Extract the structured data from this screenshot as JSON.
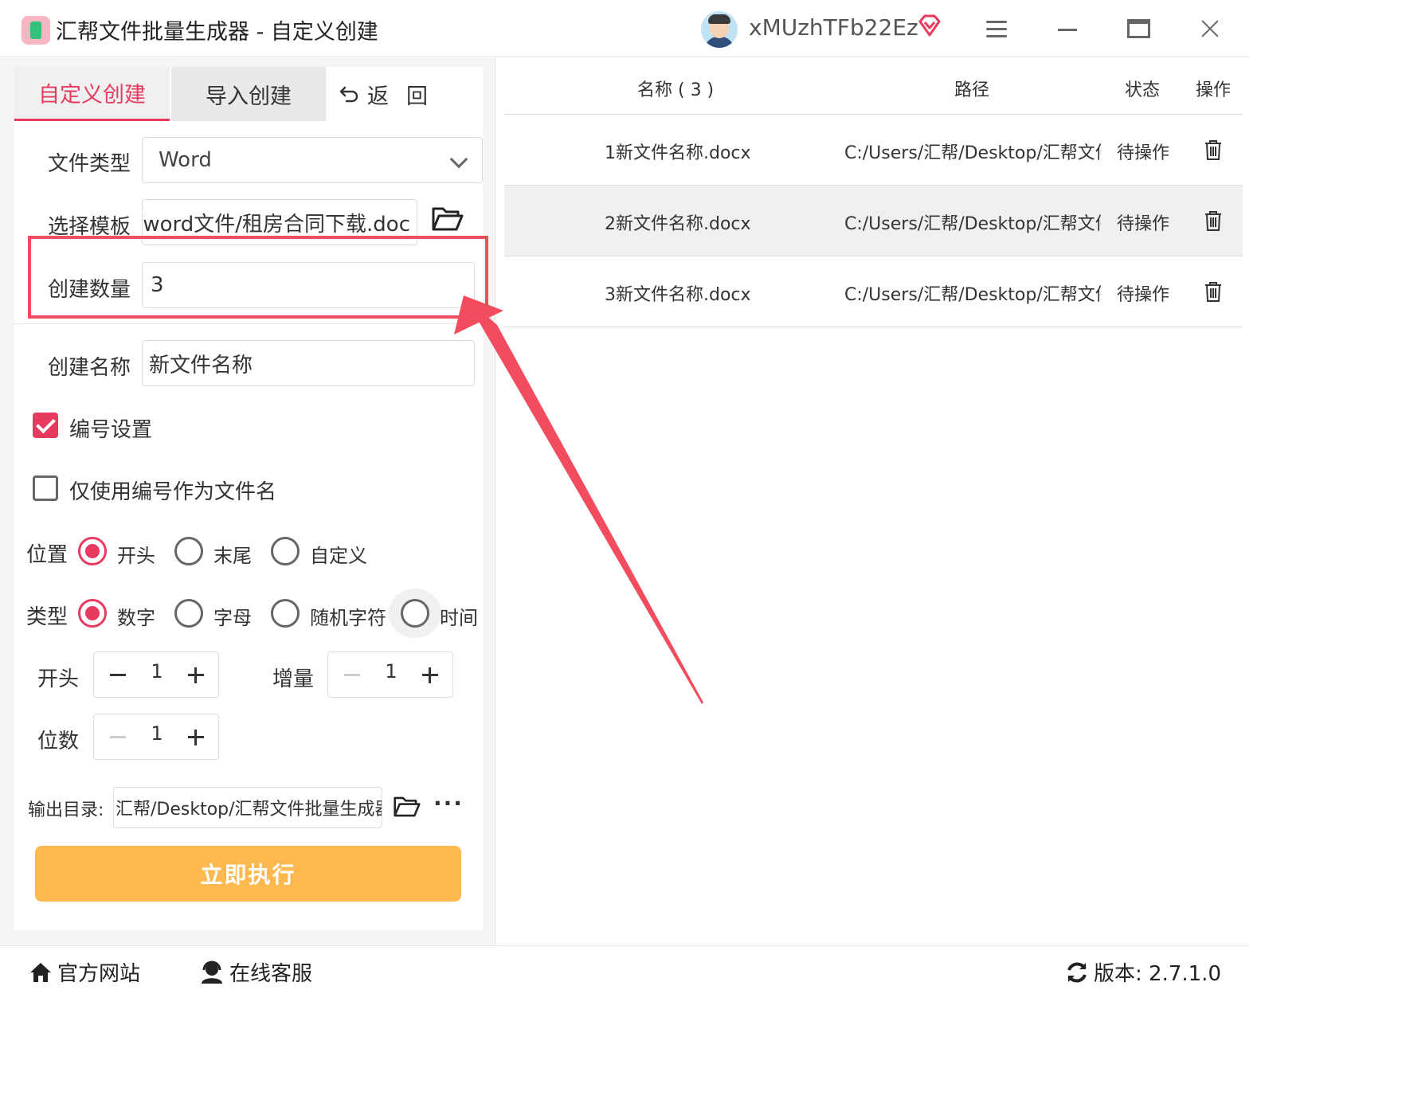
{
  "app": {
    "title": "汇帮文件批量生成器 - 自定义创建",
    "username": "xMUzhTFb22Ez"
  },
  "tabs": {
    "custom": "自定义创建",
    "import": "导入创建",
    "back": "返",
    "back2": "回"
  },
  "form": {
    "file_type_label": "文件类型",
    "file_type_value": "Word",
    "template_label": "选择模板",
    "template_value": "E:/word文件/租房合同下载.doc",
    "count_label": "创建数量",
    "count_value": "3",
    "name_label": "创建名称",
    "name_value": "新文件名称",
    "numbering_label": "编号设置",
    "numbering_checked": true,
    "only_number_label": "仅使用编号作为文件名",
    "only_number_checked": false,
    "position_label": "位置",
    "position_options": [
      "开头",
      "末尾",
      "自定义"
    ],
    "position_selected": "开头",
    "type_label": "类型",
    "type_options": [
      "数字",
      "字母",
      "随机字符",
      "时间"
    ],
    "type_selected": "数字",
    "start_label": "开头",
    "start_value": "1",
    "increment_label": "增量",
    "increment_value": "1",
    "digits_label": "位数",
    "digits_value": "1",
    "output_label": "输出目录:",
    "output_value": "汇帮/Desktop/汇帮文件批量生成器",
    "more_label": "···",
    "run_button": "立即执行"
  },
  "table": {
    "headers": {
      "name": "名称 ( 3 )",
      "path": "路径",
      "status": "状态",
      "action": "操作"
    },
    "rows": [
      {
        "name": "1新文件名称.docx",
        "path": "C:/Users/汇帮/Desktop/汇帮文件",
        "status": "待操作"
      },
      {
        "name": "2新文件名称.docx",
        "path": "C:/Users/汇帮/Desktop/汇帮文件",
        "status": "待操作"
      },
      {
        "name": "3新文件名称.docx",
        "path": "C:/Users/汇帮/Desktop/汇帮文件",
        "status": "待操作"
      }
    ]
  },
  "footer": {
    "website": "官方网站",
    "service": "在线客服",
    "version": "版本: 2.7.1.0"
  },
  "colors": {
    "accent": "#e8395f",
    "run_button": "#fdb94f",
    "annotation": "#f24d5e"
  }
}
